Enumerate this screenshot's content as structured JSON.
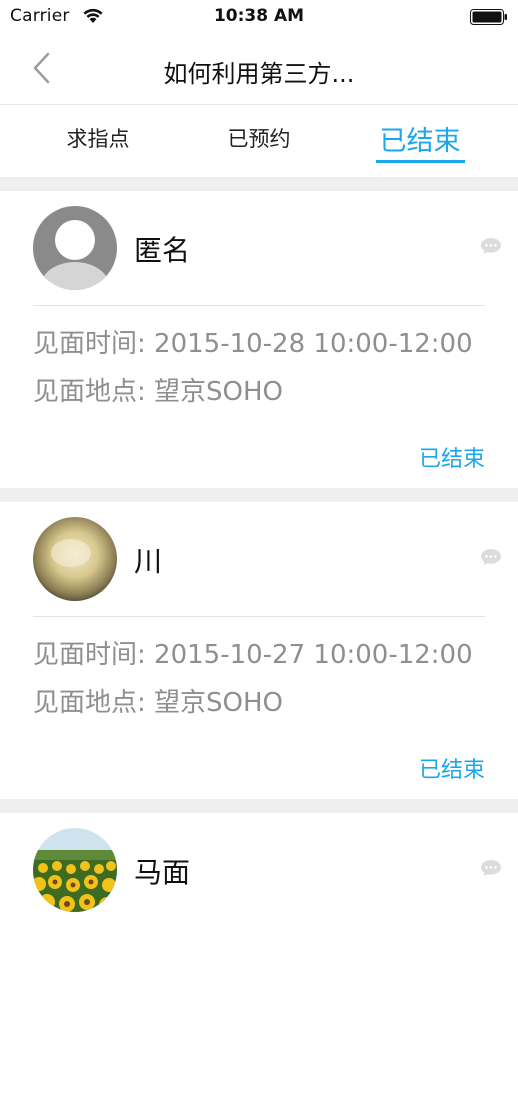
{
  "status_bar": {
    "carrier": "Carrier",
    "time": "10:38 AM"
  },
  "nav": {
    "title": "如何利用第三方..."
  },
  "tabs": [
    {
      "label": "求指点",
      "active": false
    },
    {
      "label": "已预约",
      "active": false
    },
    {
      "label": "已结束",
      "active": true
    }
  ],
  "appointments": [
    {
      "name": "匿名",
      "time_label": "见面时间:",
      "time": "2015-10-28 10:00-12:00",
      "place_label": "见面地点:",
      "place": "望京SOHO",
      "status": "已结束",
      "avatar": "default-avatar"
    },
    {
      "name": "川",
      "time_label": "见面时间:",
      "time": "2015-10-27 10:00-12:00",
      "place_label": "见面地点:",
      "place": "望京SOHO",
      "status": "已结束",
      "avatar": "photo-avatar"
    },
    {
      "name": "马面",
      "avatar": "sunflower-avatar"
    }
  ],
  "colors": {
    "accent": "#1aa7ee",
    "muted_text": "#8f8f8f",
    "separator": "#efefef"
  }
}
